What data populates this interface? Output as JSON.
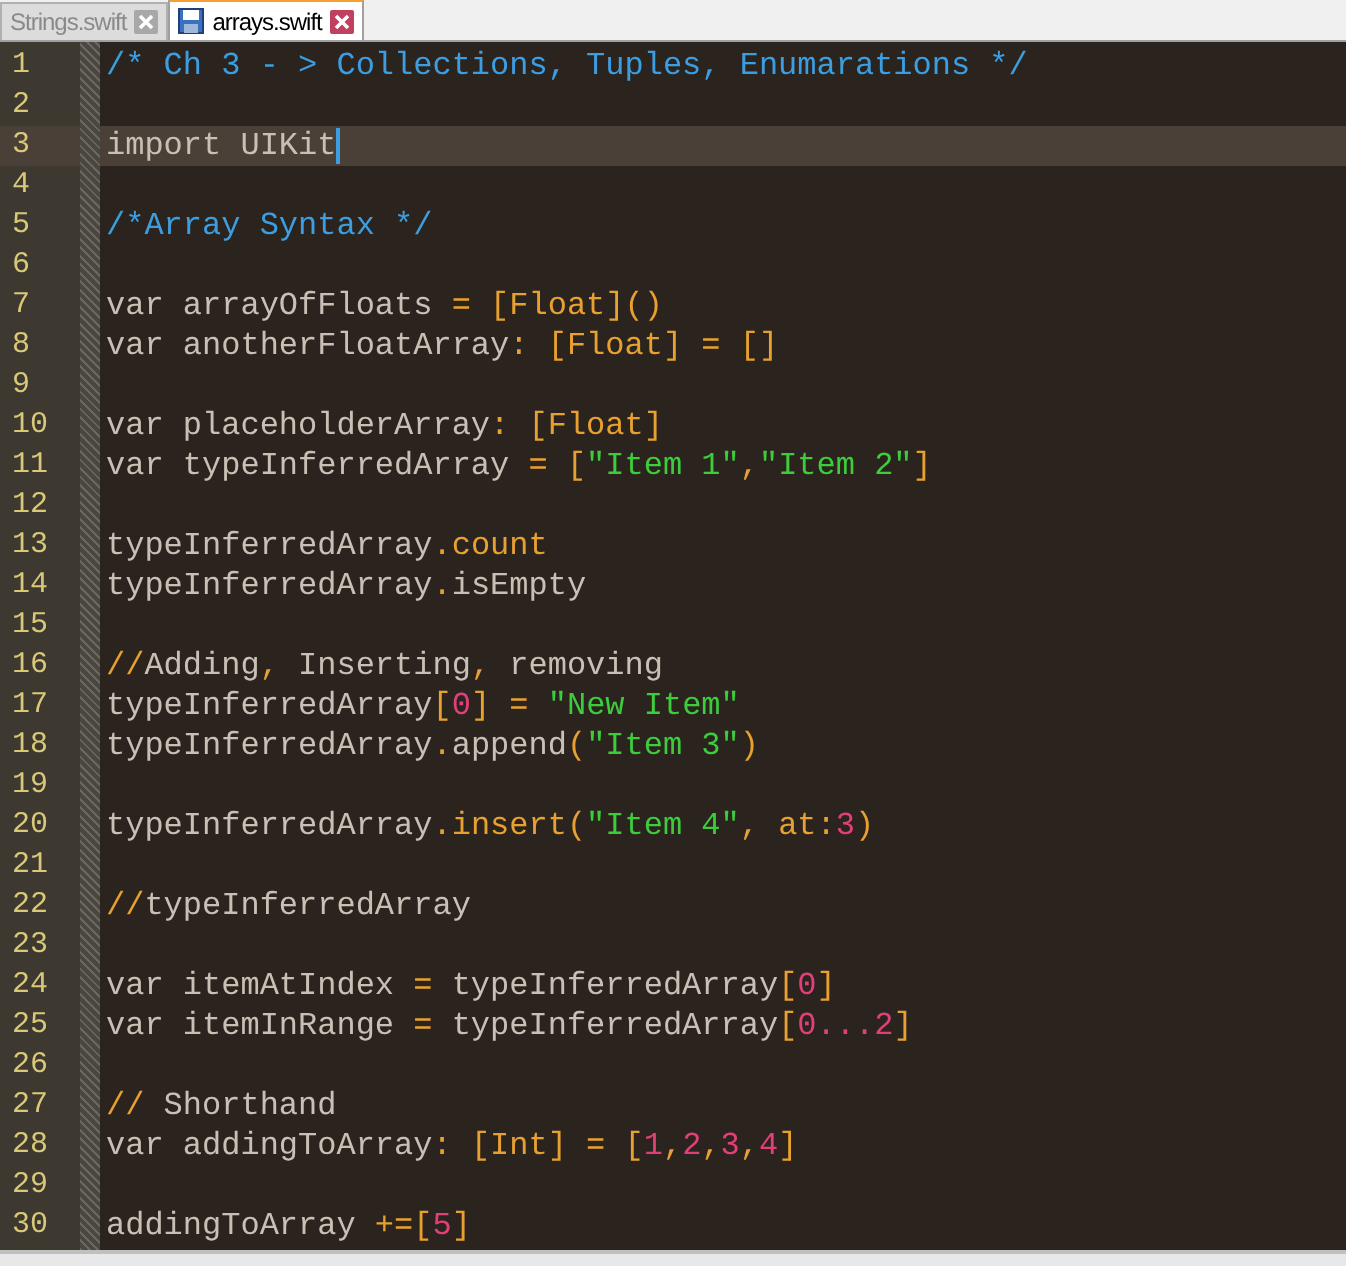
{
  "tabs": [
    {
      "label": "Strings.swift",
      "selected": false
    },
    {
      "label": "arrays.swift",
      "selected": true
    }
  ],
  "editor": {
    "lines": [
      {
        "line_number": "1",
        "current": false,
        "tokens": [
          {
            "text": "/* Ch 3 - > Collections, Tuples, Enumarations */",
            "kind": "comment"
          }
        ]
      },
      {
        "line_number": "2",
        "current": false
      },
      {
        "line_number": "3",
        "current": true,
        "tokens": [
          {
            "text": "import UIKit",
            "kind": "plain"
          }
        ]
      },
      {
        "line_number": "4",
        "current": false
      },
      {
        "line_number": "5",
        "current": false,
        "tokens": [
          {
            "text": "/*Array Syntax */",
            "kind": "comment"
          }
        ]
      },
      {
        "line_number": "6",
        "current": false
      },
      {
        "line_number": "7",
        "current": false,
        "tokens": [
          {
            "text": "var arrayOfFloats ",
            "kind": "plain"
          },
          {
            "text": "= [Float]()",
            "kind": "punct"
          }
        ]
      },
      {
        "line_number": "8",
        "current": false,
        "tokens": [
          {
            "text": "var anotherFloatArray",
            "kind": "plain"
          },
          {
            "text": ": [Float] = []",
            "kind": "punct"
          }
        ]
      },
      {
        "line_number": "9",
        "current": false
      },
      {
        "line_number": "10",
        "current": false,
        "tokens": [
          {
            "text": "var placeholderArray",
            "kind": "plain"
          },
          {
            "text": ": [Float]",
            "kind": "punct"
          }
        ]
      },
      {
        "line_number": "11",
        "current": false,
        "tokens": [
          {
            "text": "var typeInferredArray ",
            "kind": "plain"
          },
          {
            "text": "= [",
            "kind": "punct"
          },
          {
            "text": "\"Item 1\"",
            "kind": "string"
          },
          {
            "text": ",",
            "kind": "punct"
          },
          {
            "text": "\"Item 2\"",
            "kind": "string"
          },
          {
            "text": "]",
            "kind": "punct"
          }
        ]
      },
      {
        "line_number": "12",
        "current": false
      },
      {
        "line_number": "13",
        "current": false,
        "tokens": [
          {
            "text": "typeInferredArray",
            "kind": "plain"
          },
          {
            "text": ".count",
            "kind": "punct"
          }
        ]
      },
      {
        "line_number": "14",
        "current": false,
        "tokens": [
          {
            "text": "typeInferredArray",
            "kind": "plain"
          },
          {
            "text": ".",
            "kind": "punct"
          },
          {
            "text": "isEmpty",
            "kind": "plain"
          }
        ]
      },
      {
        "line_number": "15",
        "current": false
      },
      {
        "line_number": "16",
        "current": false,
        "tokens": [
          {
            "text": "//",
            "kind": "punct"
          },
          {
            "text": "Adding",
            "kind": "plain"
          },
          {
            "text": ",",
            "kind": "punct"
          },
          {
            "text": " Inserting",
            "kind": "plain"
          },
          {
            "text": ",",
            "kind": "punct"
          },
          {
            "text": " removing",
            "kind": "plain"
          }
        ]
      },
      {
        "line_number": "17",
        "current": false,
        "tokens": [
          {
            "text": "typeInferredArray",
            "kind": "plain"
          },
          {
            "text": "[",
            "kind": "punct"
          },
          {
            "text": "0",
            "kind": "number"
          },
          {
            "text": "] = ",
            "kind": "punct"
          },
          {
            "text": "\"New Item\"",
            "kind": "string"
          }
        ]
      },
      {
        "line_number": "18",
        "current": false,
        "tokens": [
          {
            "text": "typeInferredArray",
            "kind": "plain"
          },
          {
            "text": ".",
            "kind": "punct"
          },
          {
            "text": "append",
            "kind": "plain"
          },
          {
            "text": "(",
            "kind": "punct"
          },
          {
            "text": "\"Item 3\"",
            "kind": "string"
          },
          {
            "text": ")",
            "kind": "punct"
          }
        ]
      },
      {
        "line_number": "19",
        "current": false
      },
      {
        "line_number": "20",
        "current": false,
        "tokens": [
          {
            "text": "typeInferredArray",
            "kind": "plain"
          },
          {
            "text": ".insert(",
            "kind": "punct"
          },
          {
            "text": "\"Item 4\"",
            "kind": "string"
          },
          {
            "text": ", at:",
            "kind": "punct"
          },
          {
            "text": "3",
            "kind": "number"
          },
          {
            "text": ")",
            "kind": "punct"
          }
        ]
      },
      {
        "line_number": "21",
        "current": false
      },
      {
        "line_number": "22",
        "current": false,
        "tokens": [
          {
            "text": "//",
            "kind": "punct"
          },
          {
            "text": "typeInferredArray",
            "kind": "plain"
          }
        ]
      },
      {
        "line_number": "23",
        "current": false
      },
      {
        "line_number": "24",
        "current": false,
        "tokens": [
          {
            "text": "var itemAtIndex ",
            "kind": "plain"
          },
          {
            "text": "= ",
            "kind": "punct"
          },
          {
            "text": "typeInferredArray",
            "kind": "plain"
          },
          {
            "text": "[",
            "kind": "punct"
          },
          {
            "text": "0",
            "kind": "number"
          },
          {
            "text": "]",
            "kind": "punct"
          }
        ]
      },
      {
        "line_number": "25",
        "current": false,
        "tokens": [
          {
            "text": "var itemInRange ",
            "kind": "plain"
          },
          {
            "text": "= ",
            "kind": "punct"
          },
          {
            "text": "typeInferredArray",
            "kind": "plain"
          },
          {
            "text": "[",
            "kind": "punct"
          },
          {
            "text": "0...2",
            "kind": "number"
          },
          {
            "text": "]",
            "kind": "punct"
          }
        ]
      },
      {
        "line_number": "26",
        "current": false
      },
      {
        "line_number": "27",
        "current": false,
        "tokens": [
          {
            "text": "//",
            "kind": "punct"
          },
          {
            "text": " Shorthand",
            "kind": "plain"
          }
        ]
      },
      {
        "line_number": "28",
        "current": false,
        "tokens": [
          {
            "text": "var addingToArray",
            "kind": "plain"
          },
          {
            "text": ": [Int] = [",
            "kind": "punct"
          },
          {
            "text": "1",
            "kind": "number"
          },
          {
            "text": ",",
            "kind": "punct"
          },
          {
            "text": "2",
            "kind": "number"
          },
          {
            "text": ",",
            "kind": "punct"
          },
          {
            "text": "3",
            "kind": "number"
          },
          {
            "text": ",",
            "kind": "punct"
          },
          {
            "text": "4",
            "kind": "number"
          },
          {
            "text": "]",
            "kind": "punct"
          }
        ]
      },
      {
        "line_number": "29",
        "current": false
      },
      {
        "line_number": "30",
        "current": false,
        "tokens": [
          {
            "text": "addingToArray ",
            "kind": "plain"
          },
          {
            "text": "+=[",
            "kind": "punct"
          },
          {
            "text": "5",
            "kind": "number"
          },
          {
            "text": "]",
            "kind": "punct"
          }
        ]
      }
    ]
  }
}
